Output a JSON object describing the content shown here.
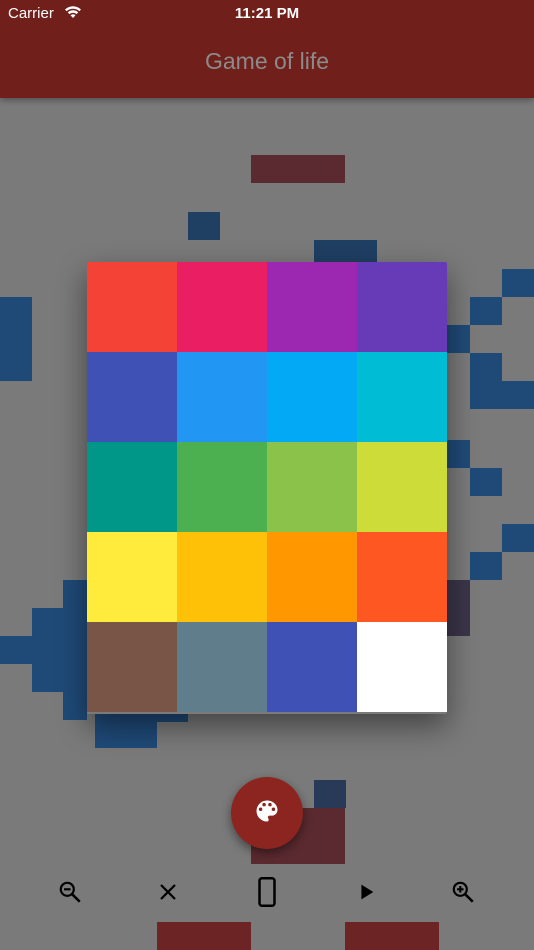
{
  "status_bar": {
    "carrier": "Carrier",
    "time": "11:21 PM",
    "wifi_icon": "wifi-icon"
  },
  "app_bar": {
    "title": "Game of life",
    "color": "#711f1a"
  },
  "palette": {
    "colors": [
      "#f44336",
      "#e91e63",
      "#9c27b0",
      "#673ab7",
      "#3f51b5",
      "#2196f3",
      "#03a9f4",
      "#00bcd4",
      "#009688",
      "#4caf50",
      "#8bc34a",
      "#cddc39",
      "#ffeb3b",
      "#ffc107",
      "#ff9800",
      "#ff5722",
      "#795548",
      "#607d8b",
      "#3f51b5",
      "#ffffff"
    ]
  },
  "fab": {
    "icon": "palette-icon",
    "color": "#8c251f"
  },
  "toolbar": {
    "items": [
      {
        "name": "zoom-out",
        "icon": "zoom-out-icon"
      },
      {
        "name": "clear",
        "icon": "close-icon"
      },
      {
        "name": "device",
        "icon": "phone-icon"
      },
      {
        "name": "play",
        "icon": "play-icon"
      },
      {
        "name": "zoom-in",
        "icon": "zoom-in-icon"
      }
    ]
  }
}
